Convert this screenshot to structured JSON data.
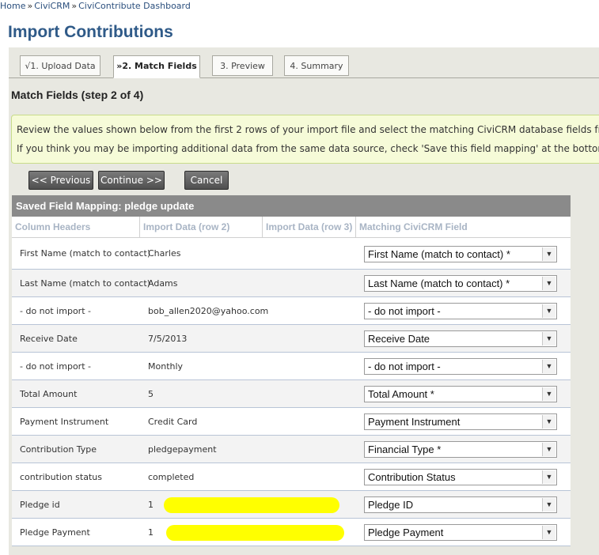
{
  "breadcrumb": {
    "items": [
      "Home",
      "CiviCRM",
      "CiviContribute Dashboard"
    ],
    "separator": "»"
  },
  "page_title": "Import Contributions",
  "wizard": {
    "steps": [
      {
        "label": "√1. Upload Data",
        "state": "done"
      },
      {
        "label": "»2. Match Fields",
        "state": "active"
      },
      {
        "label": "3. Preview",
        "state": "pending"
      },
      {
        "label": "4. Summary",
        "state": "pending"
      }
    ]
  },
  "step_title": "Match Fields (step 2 of 4)",
  "help": {
    "line1": "Review the values shown below from the first 2 rows of your import file and select the matching CiviCRM database fields from the drop-c",
    "line2": "If you think you may be importing additional data from the same data source, check 'Save this field mapping' at the bottom of the page be"
  },
  "buttons": {
    "previous": "<< Previous",
    "continue": "Continue >>",
    "cancel": "Cancel"
  },
  "mapping": {
    "title": "Saved Field Mapping: pledge update",
    "headers": [
      "Column Headers",
      "Import Data (row 2)",
      "Import Data (row 3)",
      "Matching CiviCRM Field"
    ],
    "rows": [
      {
        "column": "First Name (match to contact)",
        "row2": "Charles",
        "field": "First Name (match to contact) *"
      },
      {
        "column": "Last Name (match to contact)",
        "row2": "Adams",
        "field": "Last Name (match to contact) *"
      },
      {
        "column": "- do not import -",
        "row2": "bob_allen2020@yahoo.com",
        "field": "- do not import -"
      },
      {
        "column": "Receive Date",
        "row2": "7/5/2013",
        "field": "Receive Date"
      },
      {
        "column": "- do not import -",
        "row2": "Monthly",
        "field": "- do not import -"
      },
      {
        "column": "Total Amount",
        "row2": "5",
        "field": "Total Amount *"
      },
      {
        "column": "Payment Instrument",
        "row2": "Credit Card",
        "field": "Payment Instrument"
      },
      {
        "column": "Contribution Type",
        "row2": "pledgepayment",
        "field": "Financial Type *"
      },
      {
        "column": "contribution status",
        "row2": "completed",
        "field": "Contribution Status"
      },
      {
        "column": "Pledge id",
        "row2": "1",
        "field": "Pledge ID"
      },
      {
        "column": "Pledge Payment",
        "row2": "1",
        "field": "Pledge Payment"
      }
    ]
  },
  "colors": {
    "title": "#2f5a88",
    "link": "#2b4f7d",
    "help_bg": "#f6fbd8",
    "redaction": "#ffff00",
    "button": "#4f4f4f"
  },
  "icons": {
    "dropdown": "chevron-down-icon"
  }
}
